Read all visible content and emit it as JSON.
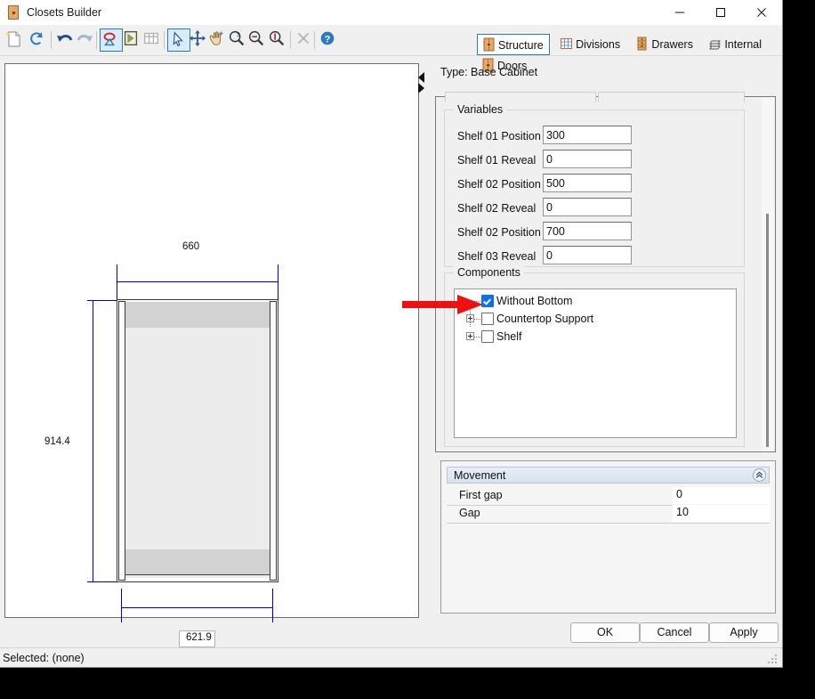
{
  "window": {
    "title": "Closets Builder",
    "icon": "cabinet-icon",
    "controls": {
      "minimize": "minimize-icon",
      "maximize": "maximize-icon",
      "close": "close-icon"
    }
  },
  "toolbar": {
    "items": [
      {
        "name": "new-icon",
        "selected": false
      },
      {
        "name": "refresh-icon",
        "selected": false
      },
      {
        "name": "undo-icon",
        "selected": false
      },
      {
        "name": "redo-icon",
        "selected": false
      },
      {
        "name": "edit-shape-icon",
        "selected": true
      },
      {
        "name": "extrude-icon",
        "selected": false
      },
      {
        "name": "grid-icon",
        "selected": false
      },
      {
        "name": "select-arrow-icon",
        "selected": true
      },
      {
        "name": "pan-move-icon",
        "selected": false
      },
      {
        "name": "hand-drag-icon",
        "selected": false
      },
      {
        "name": "zoom-window-icon",
        "selected": false
      },
      {
        "name": "zoom-out-icon",
        "selected": false
      },
      {
        "name": "zoom-extents-icon",
        "selected": false
      },
      {
        "name": "delete-icon",
        "selected": false
      },
      {
        "name": "help-icon",
        "selected": false
      }
    ]
  },
  "tabs": [
    {
      "label": "Structure",
      "icon": "cabinet-icon",
      "active": true
    },
    {
      "label": "Divisions",
      "icon": "grid-icon",
      "active": false
    },
    {
      "label": "Drawers",
      "icon": "drawers-icon",
      "active": false
    },
    {
      "label": "Internal",
      "icon": "internal-icon",
      "active": false
    },
    {
      "label": "Doors",
      "icon": "door-icon",
      "active": false
    }
  ],
  "canvas": {
    "dimensions": {
      "width_top": "660",
      "height_left": "914.4",
      "width_bottom": "621.9"
    }
  },
  "type_label": "Type: Base Cabinet",
  "variables": {
    "title": "Variables",
    "rows": [
      {
        "label": "Shelf 01 Position",
        "value": "300"
      },
      {
        "label": "Shelf 01 Reveal",
        "value": "0"
      },
      {
        "label": "Shelf 02 Position",
        "value": "500"
      },
      {
        "label": "Shelf 02 Reveal",
        "value": "0"
      },
      {
        "label": "Shelf 02 Position",
        "value": "700"
      },
      {
        "label": "Shelf 03 Reveal",
        "value": "0"
      }
    ]
  },
  "components": {
    "title": "Components",
    "items": [
      {
        "label": "Without Bottom",
        "checked": true,
        "expandable": false
      },
      {
        "label": "Countertop Support",
        "checked": false,
        "expandable": true
      },
      {
        "label": "Shelf",
        "checked": false,
        "expandable": true
      }
    ]
  },
  "movement": {
    "title": "Movement",
    "collapse_icon": "chevron-up-icon",
    "rows": [
      {
        "name": "First gap",
        "value": "0"
      },
      {
        "name": "Gap",
        "value": "10"
      }
    ]
  },
  "buttons": {
    "ok": "OK",
    "cancel": "Cancel",
    "apply": "Apply"
  },
  "statusbar": {
    "text": "Selected: (none)"
  },
  "annotation": {
    "color": "#ee1111",
    "points_to": "without-bottom-checkbox"
  },
  "colors": {
    "accent": "#2a7ac0",
    "dimension": "#0000cd",
    "checked": "#0d6efd",
    "annotation": "#ee1111"
  }
}
